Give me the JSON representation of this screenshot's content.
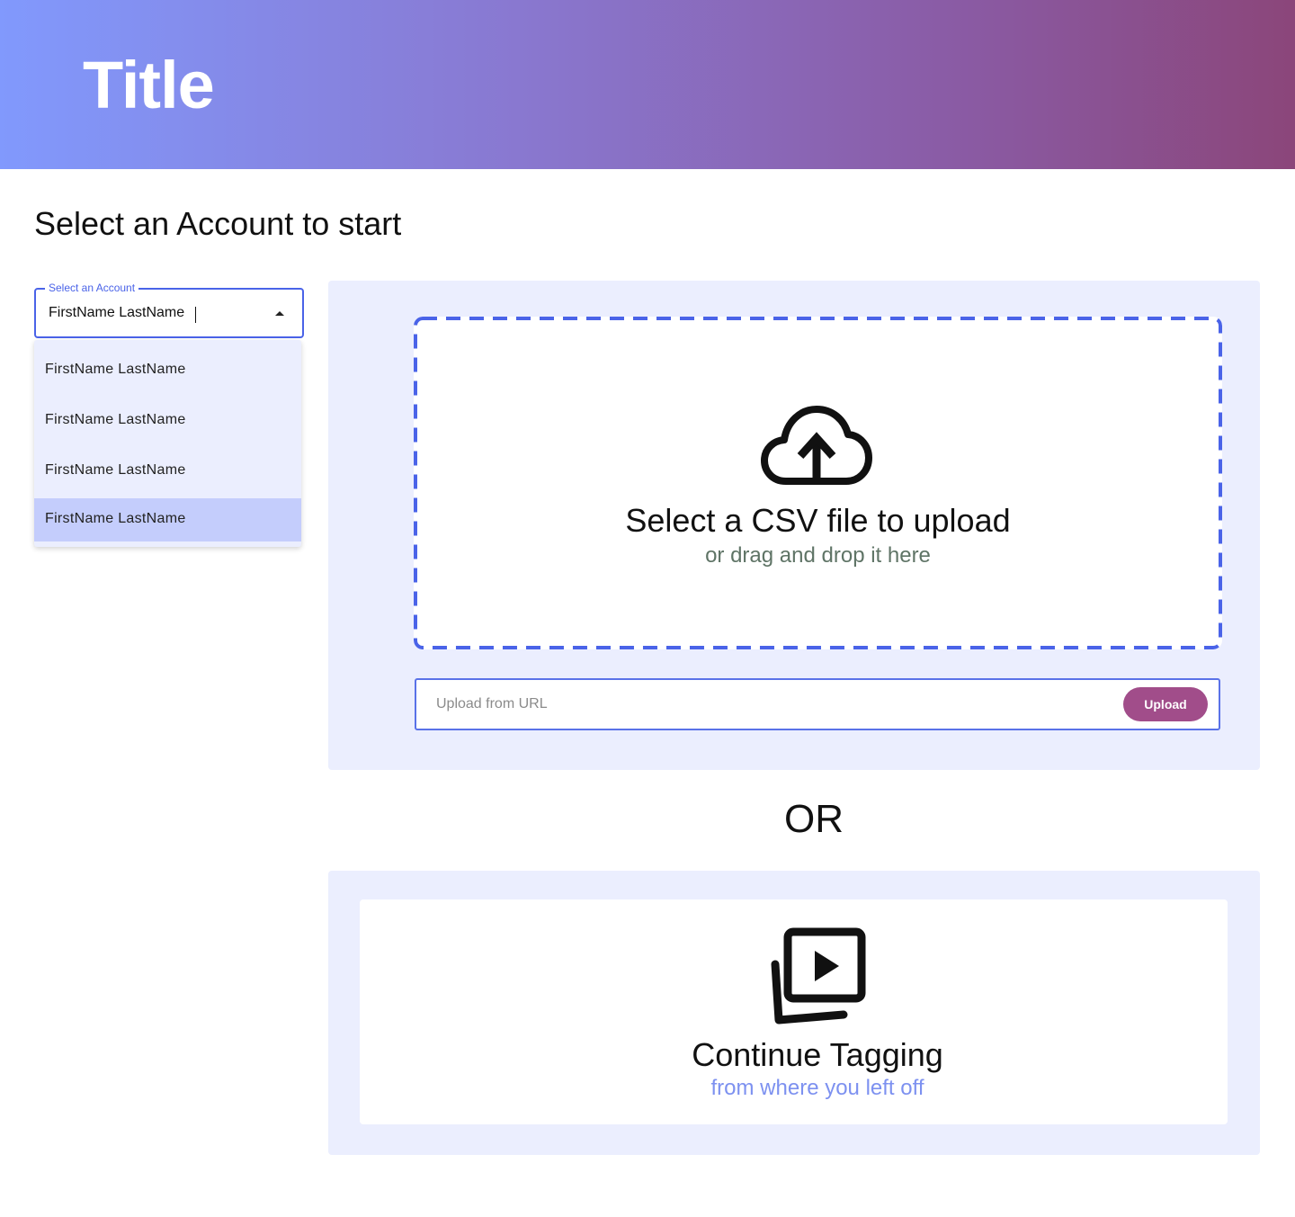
{
  "header": {
    "title": "Title"
  },
  "page": {
    "heading": "Select an Account to start"
  },
  "account_select": {
    "label": "Select an Account",
    "value": "FirstName LastName",
    "options": [
      "FirstName LastName",
      "FirstName LastName",
      "FirstName LastName",
      "FirstName LastName"
    ],
    "selected_index": 3
  },
  "upload": {
    "icon": "cloud-upload-icon",
    "title": "Select a CSV file to upload",
    "subtitle": "or drag and drop it here",
    "url_placeholder": "Upload from URL",
    "url_value": "",
    "button_label": "Upload"
  },
  "separator": {
    "text": "OR"
  },
  "continue": {
    "icon": "video-library-icon",
    "title": "Continue Tagging",
    "subtitle": "from where you left off"
  },
  "colors": {
    "accent": "#4a63e8",
    "button": "#a14d8a",
    "panel": "#ebeefe",
    "selected_option": "#c4cdfc",
    "subtitle_green": "#5f7466",
    "subtitle_blue": "#7d91f0"
  }
}
